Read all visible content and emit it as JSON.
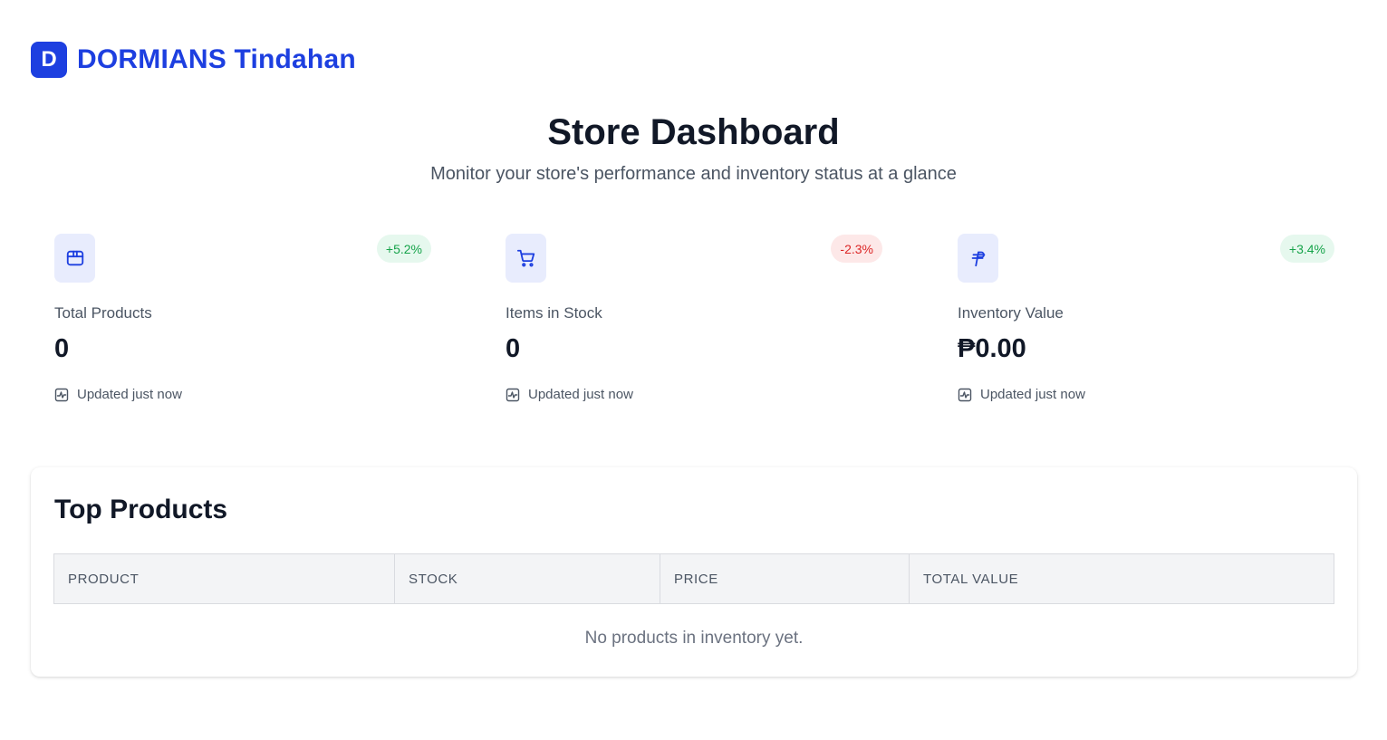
{
  "brand": {
    "badge": "D",
    "name": "DORMIANS Tindahan"
  },
  "header": {
    "title": "Store Dashboard",
    "subtitle": "Monitor your store's performance and inventory status at a glance"
  },
  "stats": [
    {
      "icon": "package-icon",
      "label": "Total Products",
      "value": "0",
      "change": "+5.2%",
      "trend": "up",
      "updated": "Updated just now"
    },
    {
      "icon": "shopping-cart-icon",
      "label": "Items in Stock",
      "value": "0",
      "change": "-2.3%",
      "trend": "down",
      "updated": "Updated just now"
    },
    {
      "icon": "peso-sign-icon",
      "label": "Inventory Value",
      "value": "₱0.00",
      "change": "+3.4%",
      "trend": "up",
      "updated": "Updated just now"
    }
  ],
  "top_products": {
    "title": "Top Products",
    "columns": [
      "PRODUCT",
      "STOCK",
      "PRICE",
      "TOTAL VALUE"
    ],
    "empty_message": "No products in inventory yet."
  },
  "colors": {
    "brand": "#1d3fe0",
    "positive": "#16a34a",
    "negative": "#dc2626",
    "icon_bg": "#e8ecfd"
  }
}
